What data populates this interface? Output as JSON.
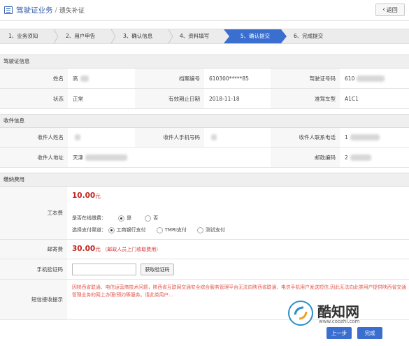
{
  "header": {
    "title": "驾驶证业务",
    "separator": "/",
    "subtitle": "遗失补证",
    "back_label": "返回"
  },
  "steps": [
    {
      "label": "1、业务须知",
      "active": false
    },
    {
      "label": "2、用户申告",
      "active": false
    },
    {
      "label": "3、确认信息",
      "active": false
    },
    {
      "label": "4、资料填写",
      "active": false
    },
    {
      "label": "5、确认提交",
      "active": true
    },
    {
      "label": "6、完成提交",
      "active": false
    }
  ],
  "license_section": {
    "title": "驾驶证信息",
    "rows": [
      [
        {
          "label": "姓名",
          "value": "高"
        },
        {
          "label": "档案编号",
          "value": "610300*****85"
        },
        {
          "label": "驾驶证号码",
          "value": "610"
        }
      ],
      [
        {
          "label": "状态",
          "value": "正常"
        },
        {
          "label": "有效期止日期",
          "value": "2018-11-18"
        },
        {
          "label": "准驾车型",
          "value": "A1C1"
        }
      ]
    ]
  },
  "recipient_section": {
    "title": "收件信息",
    "rows": [
      [
        {
          "label": "收件人姓名",
          "value": ""
        },
        {
          "label": "收件人手机号码",
          "value": ""
        },
        {
          "label": "收件人联系电话",
          "value": "1"
        }
      ],
      [
        {
          "label": "收件人地址",
          "value": "天津"
        },
        {
          "label": "邮政编码",
          "value": "2"
        }
      ]
    ]
  },
  "fee_section": {
    "title": "缴纳费用",
    "work_fee": {
      "label": "工本费",
      "amount": "10.00",
      "unit": "元",
      "online_pay_label": "是否在线缴费：",
      "online_pay_options": [
        "是",
        "否"
      ],
      "online_pay_selected": "是",
      "channel_label": "选择支付渠道：",
      "channel_options": [
        "工商银行支付",
        "TMRI支付",
        "测试支付"
      ],
      "channel_selected": "工商银行支付"
    },
    "postage": {
      "label": "邮寄费",
      "amount": "30.00",
      "unit": "元",
      "note": "（邮政人员上门收取费用）"
    },
    "verify_code": {
      "label": "手机验证码",
      "input_value": "",
      "button_label": "获取验证码"
    },
    "sms_notice": {
      "label": "短信接收提示",
      "text": "因陕西省联通、电信运营商技术问题，陕西省互联网交通安全综合服务管理平台无法向陕西省联通、电信手机用户发送短信,因此无法向此类用户提供陕西省交通管理业务的网上办理/预约等服务。请此类用户…"
    }
  },
  "actions": {
    "prev_label": "上一步",
    "finish_label": "完成"
  },
  "watermark": {
    "text": "酷知网",
    "url": "www.coozhi.com"
  },
  "colors": {
    "accent": "#3a6fd0",
    "title_blue": "#2e5aa8",
    "price_red": "#c2241e",
    "notice_red": "#e1564c"
  }
}
